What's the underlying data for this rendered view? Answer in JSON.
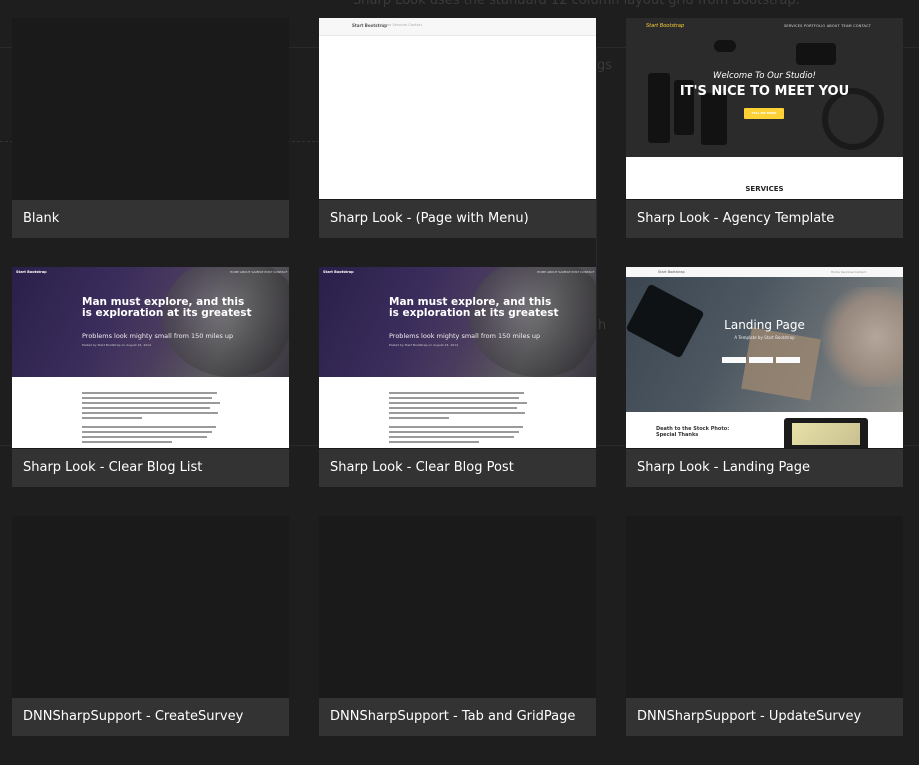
{
  "background_page": {
    "intro_text": "Sharp Look uses the standard 12 column layout grid from Bootstrap.",
    "fragment_1": "gs",
    "fragment_2": "h"
  },
  "templates": [
    {
      "caption": "Blank",
      "thumb": "blank"
    },
    {
      "caption": "Sharp Look - (Page with Menu)",
      "thumb": "menu",
      "preview": {
        "brand": "Start Bootstrap",
        "nav": "Home    Services    Contact"
      }
    },
    {
      "caption": "Sharp Look - Agency Template",
      "thumb": "agency",
      "preview": {
        "logo": "Start Bootstrap",
        "nav": "SERVICES   PORTFOLIO   ABOUT   TEAM   CONTACT",
        "welcome": "Welcome To Our Studio!",
        "headline": "IT'S NICE TO MEET YOU",
        "button": "TELL ME MORE",
        "section": "SERVICES"
      }
    },
    {
      "caption": "Sharp Look - Clear Blog List",
      "thumb": "blog",
      "preview": {
        "brand": "Start Bootstrap",
        "nav": "HOME   ABOUT   SAMPLE POST   CONTACT",
        "title": "Man must explore, and this is exploration at its greatest",
        "subtitle": "Problems look mighty small from 150 miles up",
        "meta": "Posted by Start Bootstrap on August 24, 2014"
      }
    },
    {
      "caption": "Sharp Look - Clear Blog Post",
      "thumb": "blog",
      "preview": {
        "brand": "Start Bootstrap",
        "nav": "HOME   ABOUT   SAMPLE POST   CONTACT",
        "title": "Man must explore, and this is exploration at its greatest",
        "subtitle": "Problems look mighty small from 150 miles up",
        "meta": "Posted by Start Bootstrap on August 24, 2014"
      }
    },
    {
      "caption": "Sharp Look - Landing Page",
      "thumb": "landing",
      "preview": {
        "brand": "Start Bootstrap",
        "nav": "Home   Services   Contact",
        "headline": "Landing Page",
        "subheadline": "A Template by Start Bootstrap",
        "lower_text": "Death to the Stock Photo:\nSpecial Thanks"
      }
    },
    {
      "caption": "DNNSharpSupport - CreateSurvey",
      "thumb": "blank"
    },
    {
      "caption": "DNNSharpSupport - Tab and GridPage",
      "thumb": "blank"
    },
    {
      "caption": "DNNSharpSupport - UpdateSurvey",
      "thumb": "blank"
    }
  ],
  "colors": {
    "overlay": "#1e1e1e",
    "caption_bg": "#333333",
    "caption_text": "#ffffff",
    "agency_accent": "#fed136"
  }
}
